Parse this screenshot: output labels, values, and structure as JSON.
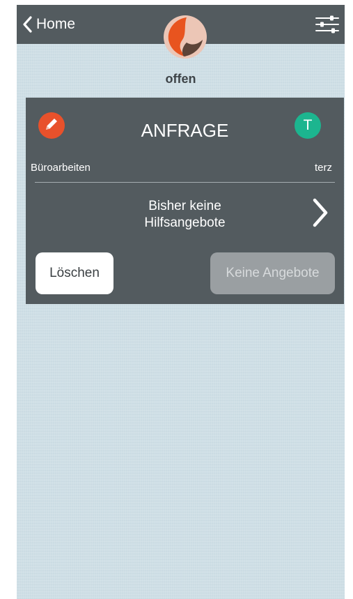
{
  "navbar": {
    "back_label": "Home",
    "icons": {
      "back": "chevron-left-icon",
      "logo": "app-logo",
      "filter": "sliders-icon"
    }
  },
  "status": {
    "label": "offen"
  },
  "request_card": {
    "title": "ANFRAGE",
    "category_icon": "pencil-icon",
    "category": "Büroarbeiten",
    "user_initial": "T",
    "user_name": "terz",
    "offers_line1": "Bisher keine",
    "offers_line2": "Hilfsangebote",
    "delete_label": "Löschen",
    "no_offers_label": "Keine Angebote"
  },
  "colors": {
    "navbar": "#535b5f",
    "card": "#535b5f",
    "background": "#cfdfe6",
    "accent_orange": "#e8512b",
    "accent_green": "#1cb58f",
    "disabled_button": "#9a9fa2"
  }
}
